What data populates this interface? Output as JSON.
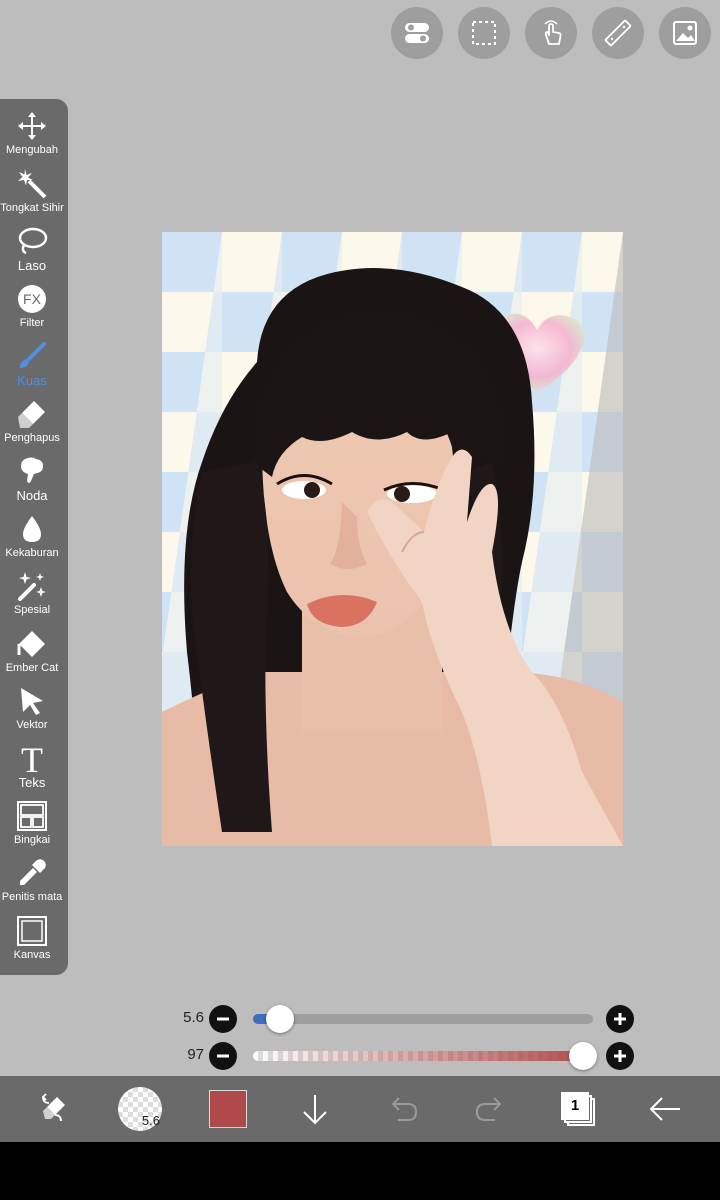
{
  "top_toolbar": {
    "buttons": [
      "toggle-icon",
      "selection-icon",
      "touch-gesture-icon",
      "ruler-icon",
      "image-icon"
    ]
  },
  "tools": [
    {
      "id": "mengubah",
      "label": "Mengubah",
      "icon": "move-icon"
    },
    {
      "id": "tongkat-sihir",
      "label": "Tongkat Sihir",
      "icon": "magic-wand-icon"
    },
    {
      "id": "laso",
      "label": "Laso",
      "icon": "lasso-icon"
    },
    {
      "id": "filter",
      "label": "Filter",
      "icon": "fx-icon",
      "icon_text": "FX"
    },
    {
      "id": "kuas",
      "label": "Kuas",
      "icon": "brush-icon",
      "active": true
    },
    {
      "id": "penghapus",
      "label": "Penghapus",
      "icon": "eraser-icon"
    },
    {
      "id": "noda",
      "label": "Noda",
      "icon": "smudge-icon"
    },
    {
      "id": "kekaburan",
      "label": "Kekaburan",
      "icon": "blur-drop-icon"
    },
    {
      "id": "spesial",
      "label": "Spesial",
      "icon": "special-sparkle-icon"
    },
    {
      "id": "ember-cat",
      "label": "Ember Cat",
      "icon": "paint-bucket-icon"
    },
    {
      "id": "vektor",
      "label": "Vektor",
      "icon": "vector-cursor-icon"
    },
    {
      "id": "teks",
      "label": "Teks",
      "icon": "text-icon",
      "icon_text": "T"
    },
    {
      "id": "bingkai",
      "label": "Bingkai",
      "icon": "frame-icon"
    },
    {
      "id": "penitis-mata",
      "label": "Penitis mata",
      "icon": "eyedropper-icon"
    },
    {
      "id": "kanvas",
      "label": "Kanvas",
      "icon": "canvas-icon"
    }
  ],
  "sliders": {
    "size": {
      "value": "5.6",
      "fraction": 0.08
    },
    "opacity": {
      "value": "97",
      "fraction": 0.97
    }
  },
  "bottom_bar": {
    "brush_size": "5.6",
    "current_color": "#b04a4a",
    "layer_count": "1",
    "icons": [
      "transform-icon",
      "brush-preview-icon",
      "color-swatch",
      "download-icon",
      "undo-icon",
      "redo-icon",
      "layers-icon",
      "back-arrow-icon"
    ]
  },
  "colors": {
    "accent": "#4d8fe6",
    "panel": "#6a6a6a",
    "background": "#bdbdbd"
  }
}
